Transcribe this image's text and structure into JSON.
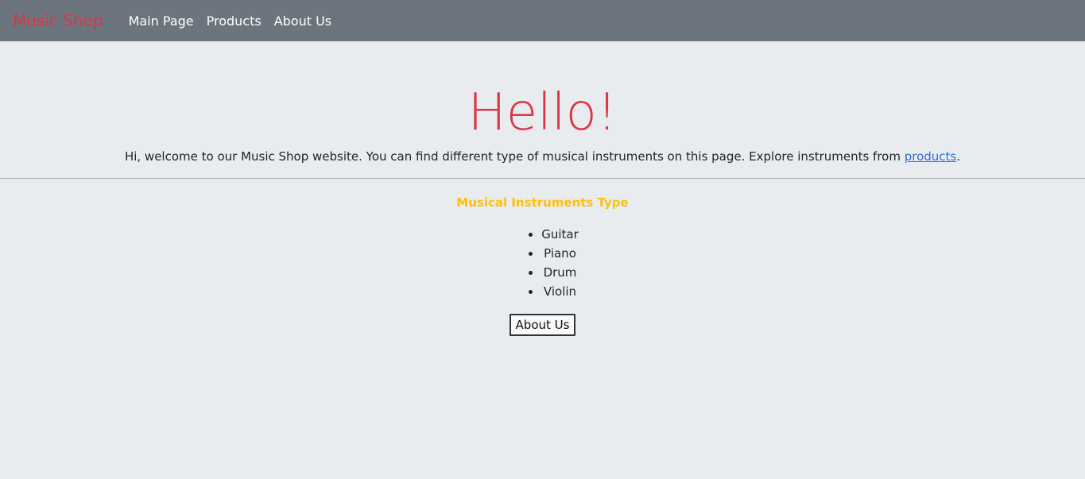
{
  "nav": {
    "brand": "Music Shop",
    "links": [
      "Main Page",
      "Products",
      "About Us"
    ]
  },
  "hero": {
    "title": "Hello!",
    "text": "Hi, welcome to our Music Shop website. You can find different type of musical instruments on this page. Explore instruments from ",
    "link_text": "products",
    "text_end": "."
  },
  "instruments": {
    "title": "Musical Instruments Type",
    "items": [
      "Guitar",
      "Piano",
      "Drum",
      "Violin"
    ]
  },
  "button": {
    "label": "About Us"
  },
  "colors": {
    "navbar_bg": "#6c757d",
    "brand": "#dc3545",
    "page_bg": "#e9ecef",
    "section_title": "#ffc107",
    "link": "#2f6fd6"
  }
}
